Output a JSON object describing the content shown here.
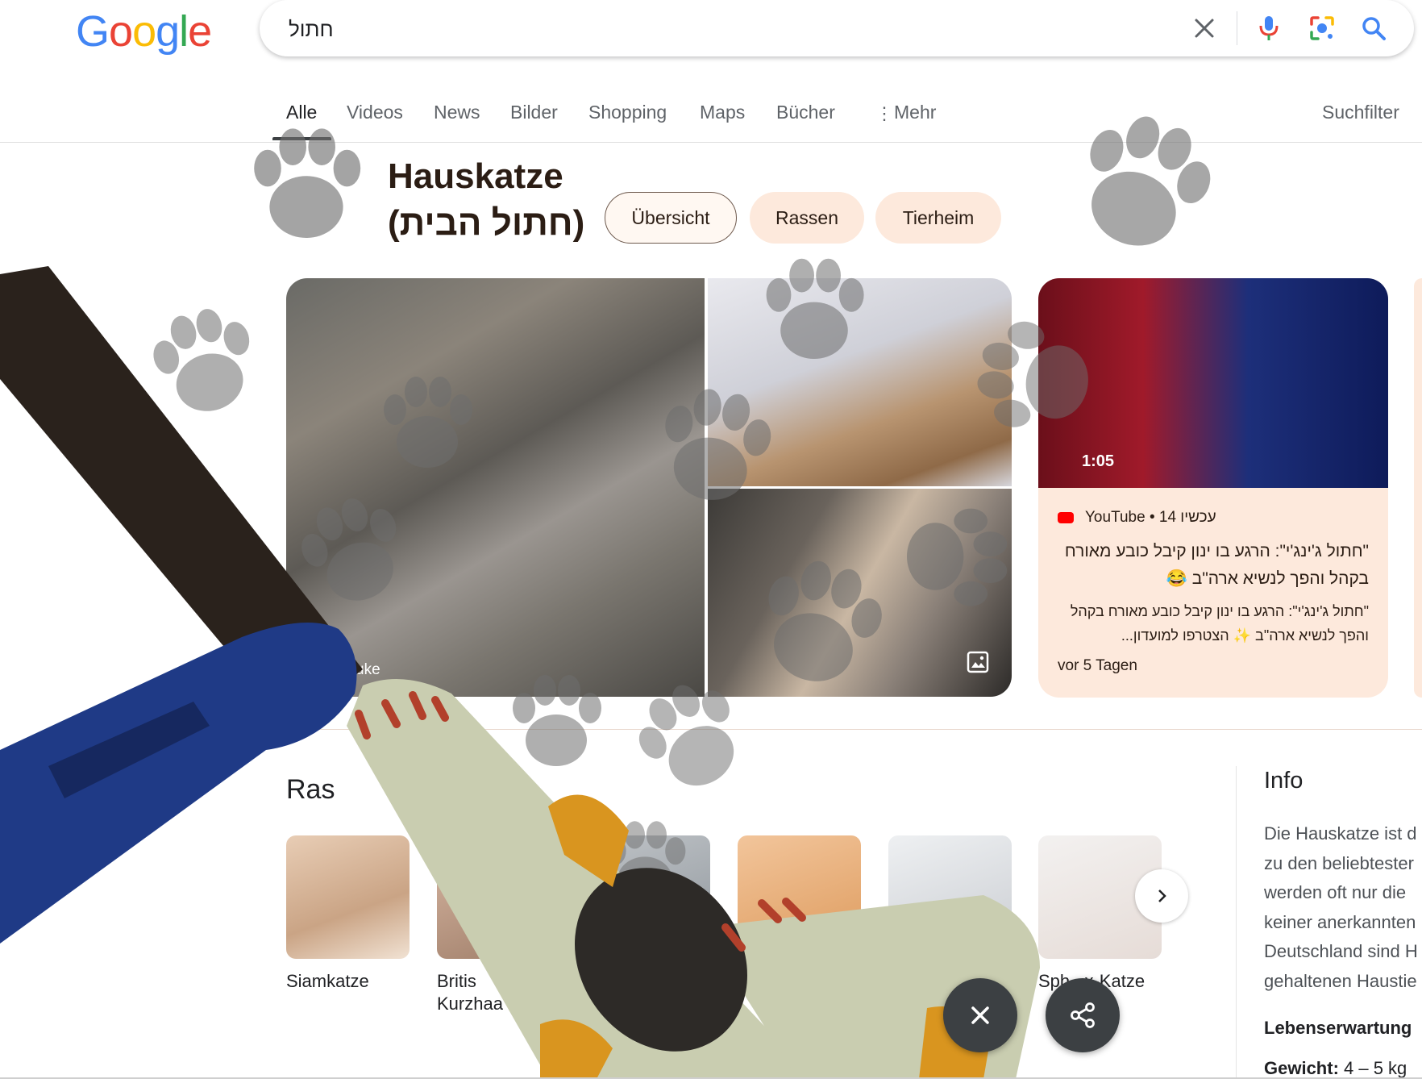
{
  "logo": {
    "letters": [
      "G",
      "o",
      "o",
      "g",
      "l",
      "e"
    ],
    "colors": [
      "#4285F4",
      "#EA4335",
      "#FBBC05",
      "#4285F4",
      "#34A853",
      "#EA4335"
    ]
  },
  "search": {
    "query": "חתול"
  },
  "tabs": {
    "items": [
      "Alle",
      "Videos",
      "News",
      "Bilder",
      "Shopping",
      "Maps",
      "Bücher",
      "Mehr"
    ],
    "tools": "Suchfilter"
  },
  "entity": {
    "title_line1": "Hauskatze",
    "title_line2": "(חתול הבית)",
    "chips": [
      "Übersicht",
      "Rassen",
      "Tierheim"
    ]
  },
  "images": {
    "source_label": "uke"
  },
  "video": {
    "duration": "1:05",
    "source": "YouTube • 14 עכשיו",
    "title": "\"חתול ג'ינג'י\": הרגע בו ינון קיבל כובע מאורח בקהל והפך לנשיא ארה\"ב 😂",
    "snippet": "\"חתול ג'ינג'י\": הרגע בו ינון קיבל כובע מאורח בקהל והפך לנשיא ארה\"ב ✨ הצטרפו למועדון...",
    "date": "vor 5 Tagen"
  },
  "breeds": {
    "heading": "Ras",
    "items": [
      {
        "name": "Siamkatze"
      },
      {
        "name": "Britis\nKurzhaa"
      },
      {
        "name": ""
      },
      {
        "name": ""
      },
      {
        "name": "gdoll"
      },
      {
        "name": "Sph   x-Katze"
      }
    ]
  },
  "info": {
    "heading": "Info",
    "text": "Die Hauskatze ist d\nzu den beliebtester\nwerden oft nur die \nkeiner anerkannten\nDeutschland sind H\ngehaltenen Haustie",
    "life_label": "Lebenserwartung",
    "weight_label": "Gewicht:",
    "weight_value": " 4 – 5 kg"
  },
  "colors": {
    "accent_chip": "#fde9dc",
    "paw": "#6e6e6e",
    "blue_leg": "#1f3a86",
    "cream_leg": "#c9cdb0"
  }
}
